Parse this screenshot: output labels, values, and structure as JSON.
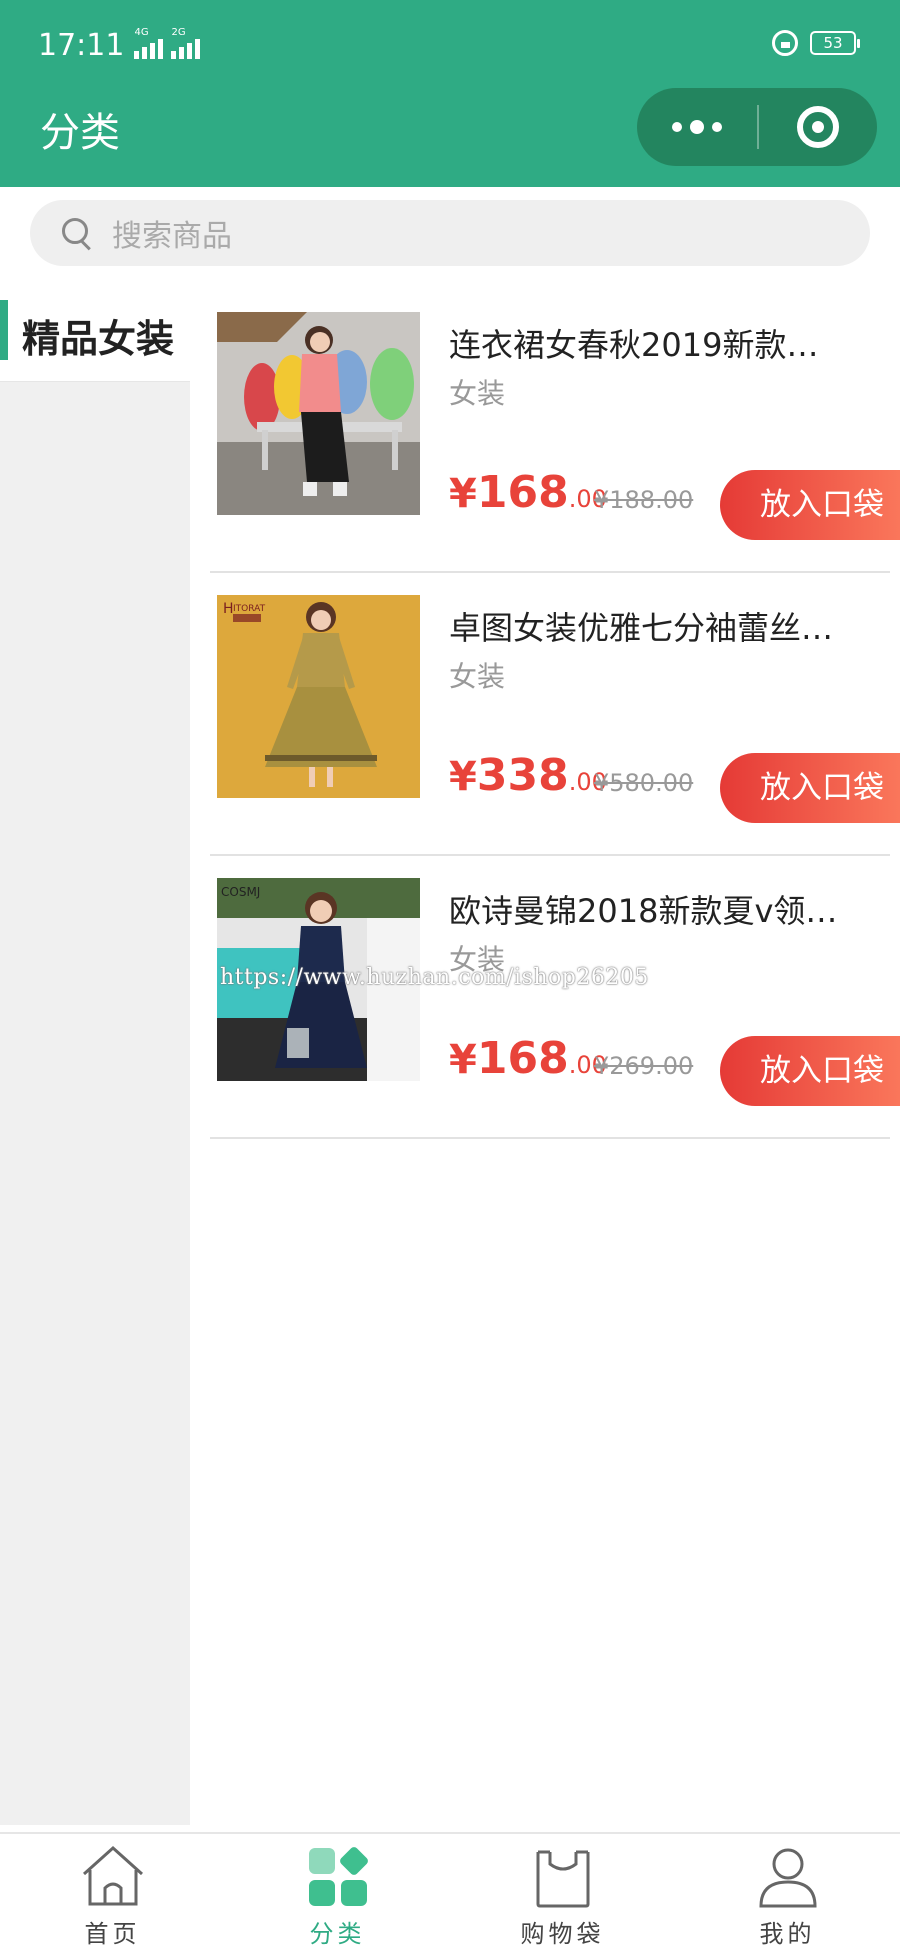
{
  "status_bar": {
    "time": "17:11",
    "network_1": "4G",
    "network_2": "2G",
    "battery": "53"
  },
  "header": {
    "title": "分类"
  },
  "search": {
    "placeholder": "搜索商品"
  },
  "sidebar": {
    "items": [
      {
        "label": "精品女装",
        "active": true
      }
    ]
  },
  "products": [
    {
      "name": "连衣裙女春秋2019新款…",
      "category": "女装",
      "currency": "¥",
      "price_int": "168",
      "price_dec": ".00",
      "old_price": "¥188.00",
      "button": "放入口袋"
    },
    {
      "name": "卓图女装优雅七分袖蕾丝…",
      "category": "女装",
      "currency": "¥",
      "price_int": "338",
      "price_dec": ".00",
      "old_price": "¥580.00",
      "button": "放入口袋"
    },
    {
      "name": "欧诗曼锦2018新款夏v领…",
      "category": "女装",
      "currency": "¥",
      "price_int": "168",
      "price_dec": ".00",
      "old_price": "¥269.00",
      "button": "放入口袋"
    }
  ],
  "watermark": "https://www.huzhan.com/ishop26205",
  "tabbar": {
    "tabs": [
      {
        "label": "首页",
        "icon": "home-icon",
        "active": false
      },
      {
        "label": "分类",
        "icon": "category-icon",
        "active": true
      },
      {
        "label": "购物袋",
        "icon": "shopping-bag-icon",
        "active": false
      },
      {
        "label": "我的",
        "icon": "user-icon",
        "active": false
      }
    ]
  },
  "colors": {
    "brand": "#2fab84",
    "price": "#e8433a",
    "button_start": "#e53a36",
    "button_end": "#fb7a5d"
  }
}
